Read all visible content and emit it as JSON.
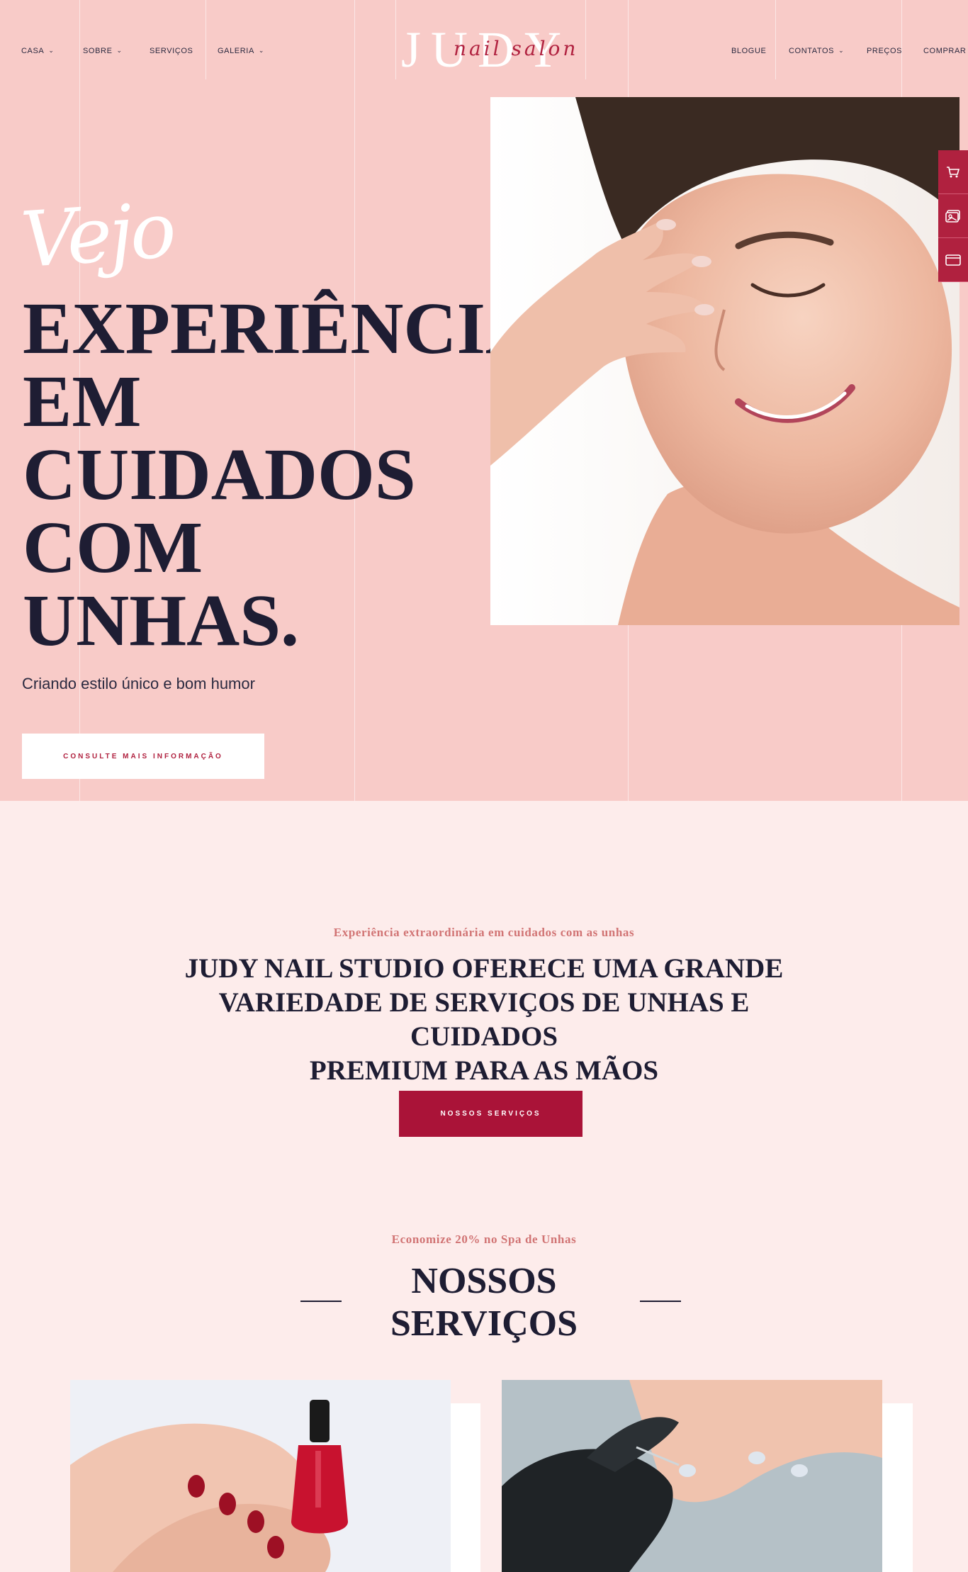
{
  "colors": {
    "hero_bg": "#f8cbc8",
    "page_bg": "#fdeceb",
    "accent": "#aa1338",
    "eyebrow": "#d17474",
    "ink": "#1e1d33"
  },
  "nav": {
    "left": [
      {
        "label": "CASA",
        "dropdown": true
      },
      {
        "label": "SOBRE",
        "dropdown": true
      },
      {
        "label": "SERVIÇOS",
        "dropdown": false
      },
      {
        "label": "GALERIA",
        "dropdown": true
      }
    ],
    "right": [
      {
        "label": "BLOGUE",
        "dropdown": false
      },
      {
        "label": "CONTATOS",
        "dropdown": true
      },
      {
        "label": "PREÇOS",
        "dropdown": false
      },
      {
        "label": "COMPRAR",
        "dropdown": false
      }
    ],
    "chevron": "⌄"
  },
  "logo": {
    "main": "JUDY",
    "script": "nail salon"
  },
  "hero": {
    "script_word": "Vejo",
    "headline": [
      "EXPERIÊNCIA",
      "EM",
      "CUIDADOS",
      "COM",
      "UNHAS."
    ],
    "subline": "Criando estilo único e bom humor",
    "cta": "CONSULTE MAIS INFORMAÇÃO"
  },
  "side_tabs": [
    "cart-icon",
    "gallery-icon",
    "browser-icon"
  ],
  "intro": {
    "eyebrow": "Experiência extraordinária em cuidados com as unhas",
    "title_lines": [
      "JUDY NAIL STUDIO OFERECE UMA GRANDE",
      "VARIEDADE DE SERVIÇOS DE UNHAS E CUIDADOS",
      "PREMIUM PARA AS MÃOS"
    ],
    "cta": "NOSSOS SERVIÇOS"
  },
  "services": {
    "eyebrow": "Economize 20% no Spa de Unhas",
    "title_lines": [
      "NOSSOS",
      "SERVIÇOS"
    ]
  }
}
